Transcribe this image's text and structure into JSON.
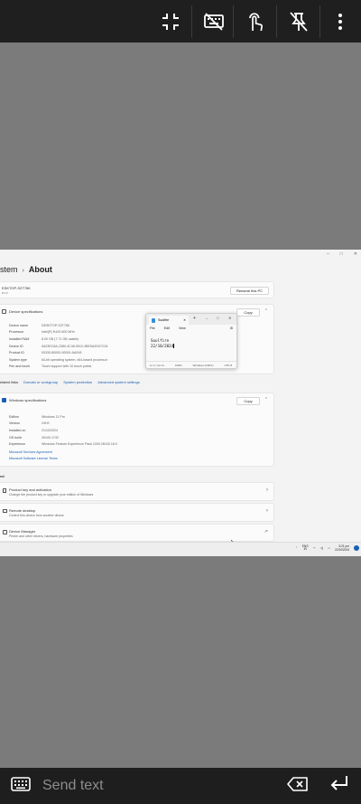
{
  "toolbar": {
    "icons": [
      "exit-fullscreen-icon",
      "keyboard-off-icon",
      "touch-mode-icon",
      "unpin-icon",
      "more-vert-icon"
    ]
  },
  "remote": {
    "window_controls": [
      "–",
      "□",
      "✕"
    ],
    "breadcrumb": {
      "parent": "stem",
      "current": "About"
    },
    "device_header": {
      "name": "ESKTOP-S2T76K",
      "sub": "Pc N",
      "rename_label": "Rename this PC"
    },
    "device_specs": {
      "title": "Device specifications",
      "copy_label": "Copy",
      "rows": [
        {
          "key": "Device name",
          "value": "DESKTOP-S2T76K"
        },
        {
          "key": "Processor",
          "value": "Intel(R) N100   800 MHz"
        },
        {
          "key": "Installed RAM",
          "value": "8.00 GB (7.71 GB usable)"
        },
        {
          "key": "Device ID",
          "value": "0A23EC8A-2380-4C46-9512-3BE5A2D07C04"
        },
        {
          "key": "Product ID",
          "value": "00330-80000-00000-AA918"
        },
        {
          "key": "System type",
          "value": "64-bit operating system, x64-based processor"
        },
        {
          "key": "Pen and touch",
          "value": "Touch support with 10 touch points"
        }
      ]
    },
    "related_links": {
      "label": "elated links",
      "links": [
        "Domain or workgroup",
        "System protection",
        "Advanced system settings"
      ]
    },
    "windows_specs": {
      "title": "Windows specifications",
      "copy_label": "Copy",
      "rows": [
        {
          "key": "Edition",
          "value": "Windows 11 Pro"
        },
        {
          "key": "Version",
          "value": "24H2"
        },
        {
          "key": "Installed on",
          "value": "21/10/2024"
        },
        {
          "key": "OS build",
          "value": "26100.1742"
        },
        {
          "key": "Experience",
          "value": "Windows Feature Experience Pack 1000.26100.18.0"
        }
      ],
      "links": [
        "Microsoft Services Agreement",
        "Microsoft Software License Terms"
      ]
    },
    "related_label": "ed",
    "related_items": [
      {
        "title": "Product key and activation",
        "sub": "Change the product key or upgrade your edition of Windows"
      },
      {
        "title": "Remote desktop",
        "sub": "Control this device from another device"
      },
      {
        "title": "Device Manager",
        "sub": "Printer and other drivers, hardware properties"
      }
    ],
    "notepad": {
      "tab_title": "Soulfire",
      "menu": [
        "File",
        "Edit",
        "View"
      ],
      "content_line1": "Soulfire",
      "content_line2": "22/10/2024",
      "status": [
        "Ln 2, Col 11",
        "100%",
        "Windows (CRLF)",
        "UTF-8"
      ]
    },
    "taskbar": {
      "lang_line1": "ENG",
      "lang_line2": "IN",
      "time": "5:21 pm",
      "date": "22/10/2024"
    }
  },
  "bottom": {
    "send_text_placeholder": "Send text"
  }
}
